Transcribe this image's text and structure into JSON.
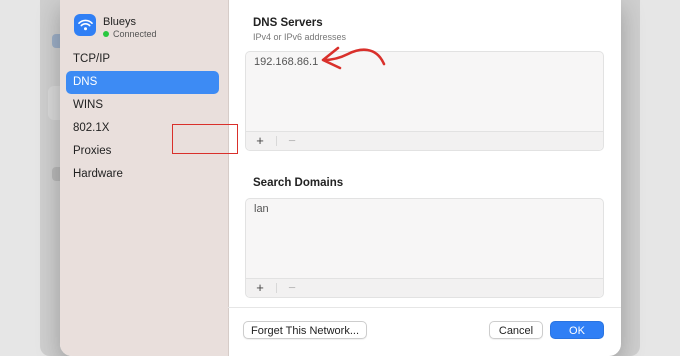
{
  "network": {
    "name": "Blueys",
    "status": "Connected"
  },
  "sidebar": {
    "items": [
      {
        "label": "TCP/IP"
      },
      {
        "label": "DNS",
        "selected": true
      },
      {
        "label": "WINS"
      },
      {
        "label": "802.1X"
      },
      {
        "label": "Proxies"
      },
      {
        "label": "Hardware"
      }
    ]
  },
  "dns": {
    "title": "DNS Servers",
    "subtitle": "IPv4 or IPv6 addresses",
    "entries": [
      "192.168.86.1"
    ],
    "add_label": "+",
    "remove_label": "−"
  },
  "search": {
    "title": "Search Domains",
    "entries": [
      "lan"
    ],
    "add_label": "+",
    "remove_label": "−"
  },
  "footer": {
    "forget_label": "Forget This Network...",
    "cancel_label": "Cancel",
    "ok_label": "OK"
  },
  "colors": {
    "accent": "#2f7ff5",
    "annotation": "#d9302b",
    "connected": "#28c840",
    "sidebar_bg": "#e9dfdc"
  },
  "icons": {
    "wifi": "wifi-icon",
    "annotation_arrow": "annotation-arrow-icon"
  }
}
